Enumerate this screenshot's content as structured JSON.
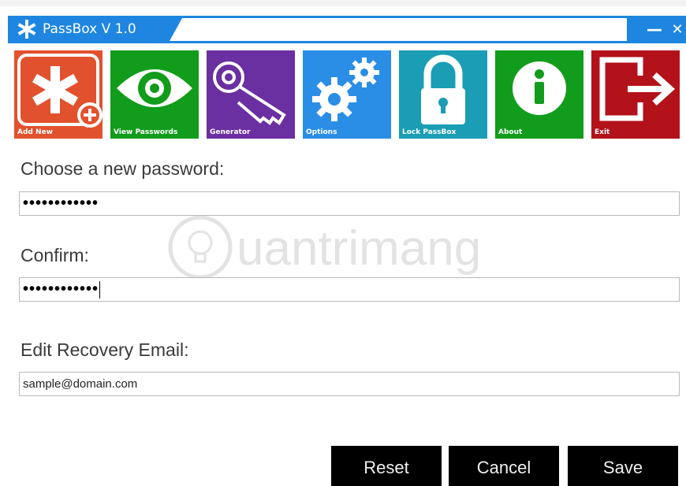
{
  "window": {
    "title": "PassBox V 1.0",
    "minimize_glyph": "—",
    "close_glyph": "✕",
    "title_icon": "asterisk-icon",
    "accent_color": "#1e86e0"
  },
  "toolbar": {
    "tiles": [
      {
        "label": "Add New",
        "icon": "asterisk-plus-icon",
        "color": "#e2512d"
      },
      {
        "label": "View Passwords",
        "icon": "eye-icon",
        "color": "#129c1b"
      },
      {
        "label": "Generator",
        "icon": "key-icon",
        "color": "#6a2fa0"
      },
      {
        "label": "Options",
        "icon": "gears-icon",
        "color": "#2b8ee6"
      },
      {
        "label": "Lock PassBox",
        "icon": "padlock-icon",
        "color": "#1a9db5"
      },
      {
        "label": "About",
        "icon": "info-icon",
        "color": "#129c1b"
      },
      {
        "label": "Exit",
        "icon": "exit-icon",
        "color": "#b3121b"
      }
    ]
  },
  "form": {
    "new_password_label": "Choose a new password:",
    "new_password_value": "••••••••••••",
    "confirm_label": "Confirm:",
    "confirm_value": "••••••••••••",
    "email_label": "Edit Recovery Email:",
    "email_value": "sample@domain.com"
  },
  "watermark": {
    "text": "uantrimang"
  },
  "buttons": {
    "reset": "Reset",
    "cancel": "Cancel",
    "save": "Save"
  }
}
